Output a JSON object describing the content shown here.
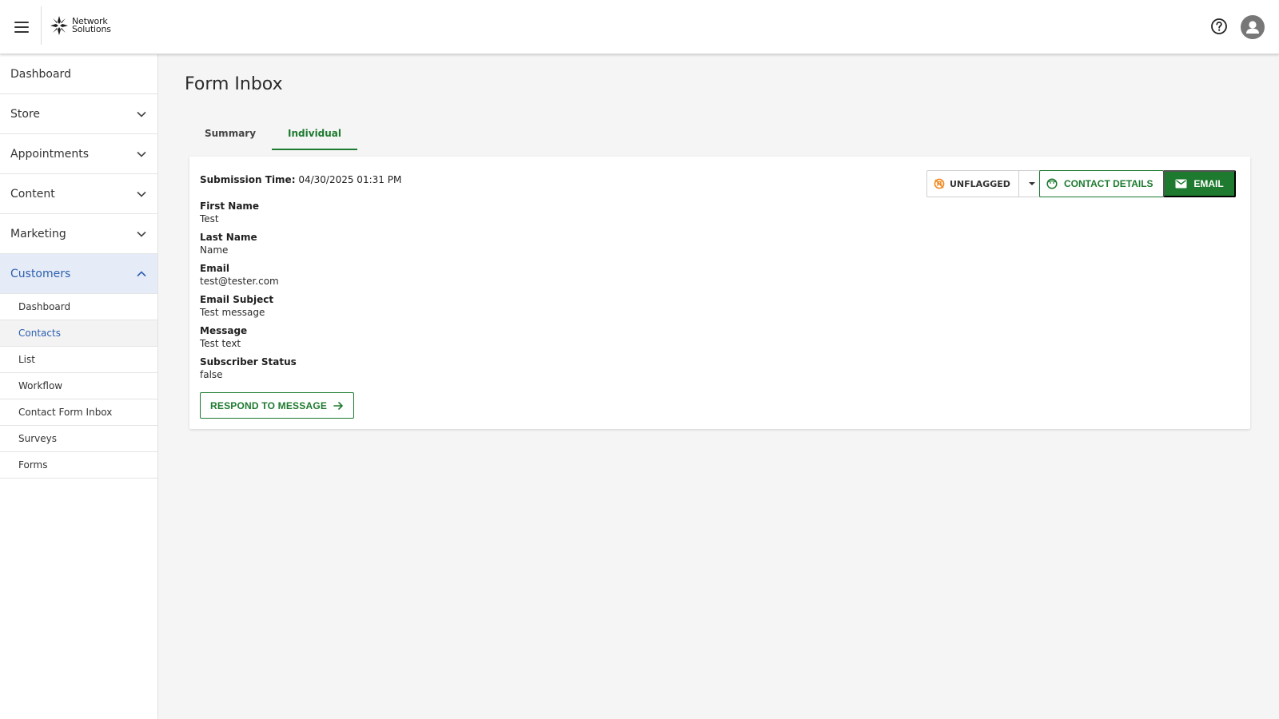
{
  "header": {
    "brand_line1": "Network",
    "brand_line2": "Solutions",
    "menu_icon": "hamburger-icon",
    "help_icon": "help-circle-icon",
    "avatar_icon": "user-avatar-icon"
  },
  "sidebar": {
    "items": [
      {
        "label": "Dashboard",
        "expandable": false
      },
      {
        "label": "Store",
        "expandable": true
      },
      {
        "label": "Appointments",
        "expandable": true
      },
      {
        "label": "Content",
        "expandable": true
      },
      {
        "label": "Marketing",
        "expandable": true
      },
      {
        "label": "Customers",
        "expandable": true,
        "expanded": true,
        "active": true
      }
    ],
    "customers_sub": [
      {
        "label": "Dashboard"
      },
      {
        "label": "Contacts",
        "active": true
      },
      {
        "label": "List"
      },
      {
        "label": "Workflow"
      },
      {
        "label": "Contact Form Inbox"
      },
      {
        "label": "Surveys"
      },
      {
        "label": "Forms"
      }
    ]
  },
  "main": {
    "title": "Form Inbox",
    "tabs": [
      {
        "label": "Summary",
        "active": false
      },
      {
        "label": "Individual",
        "active": true
      }
    ],
    "submission": {
      "time_label": "Submission Time:",
      "time_value": "04/30/2025 01:31 PM",
      "fields": [
        {
          "label": "First Name",
          "value": "Test"
        },
        {
          "label": "Last Name",
          "value": "Name"
        },
        {
          "label": "Email",
          "value": "test@tester.com"
        },
        {
          "label": "Email Subject",
          "value": "Test message"
        },
        {
          "label": "Message",
          "value": "Test text"
        },
        {
          "label": "Subscriber Status",
          "value": "false"
        }
      ]
    },
    "actions": {
      "flag_label": "UNFLAGGED",
      "flag_icon": "flag-off-icon",
      "contact_details_label": "CONTACT DETAILS",
      "email_label": "EMAIL",
      "respond_label": "RESPOND TO MESSAGE"
    }
  },
  "colors": {
    "accent_green": "#1d7a2f",
    "active_blue": "#2c5fb0",
    "active_bg": "#e6ecf7",
    "flag_orange": "#f08a24",
    "page_bg": "#f5f5f5"
  }
}
